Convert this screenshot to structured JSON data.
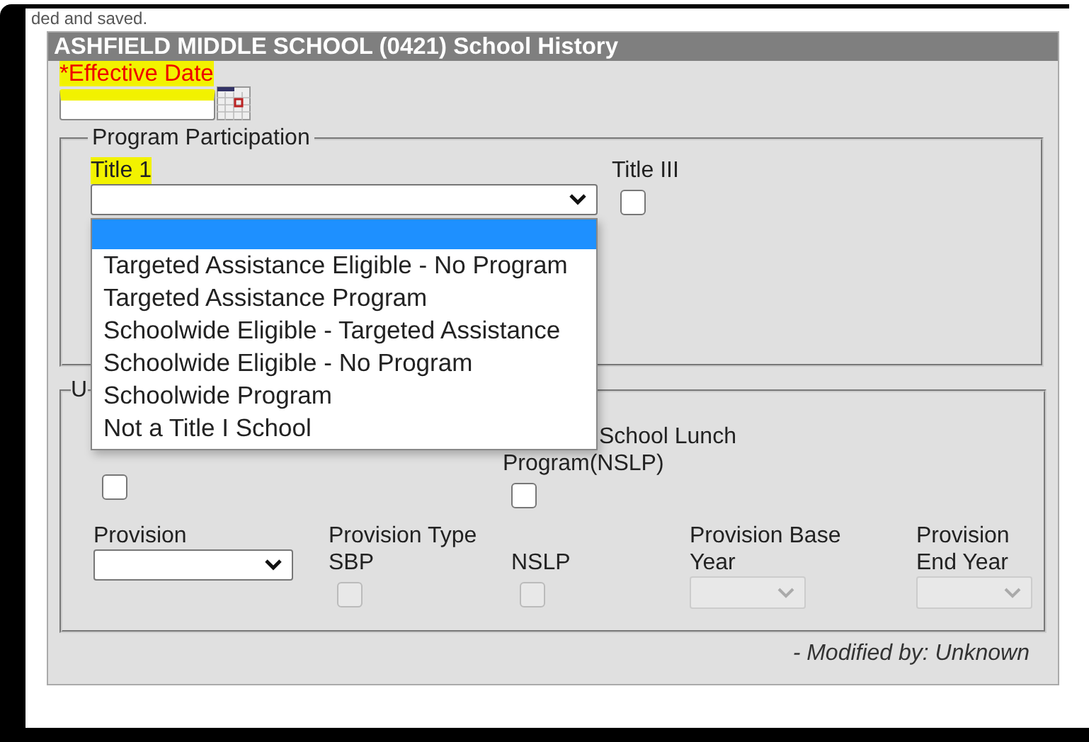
{
  "top_note": "ded and saved.",
  "panel": {
    "title": "ASHFIELD MIDDLE SCHOOL (0421) School History"
  },
  "effective_date": {
    "label": "*Effective Date",
    "highlighted": true
  },
  "program_participation": {
    "legend": "Program Participation",
    "title1": {
      "label": "Title 1",
      "highlighted": true,
      "expanded": true,
      "options": [
        {
          "selected": true
        },
        {
          "label": "Targeted Assistance Eligible - No Program",
          "selected": false
        },
        {
          "label": "Targeted Assistance Program",
          "selected": false
        },
        {
          "label": "Schoolwide Eligible - Targeted Assistance",
          "selected": false
        },
        {
          "label": "Schoolwide Eligible - No Program",
          "selected": false
        },
        {
          "label": "Schoolwide Program",
          "selected": false
        },
        {
          "label": "Not a Title I School",
          "selected": false
        }
      ]
    },
    "title3": {
      "label": "Title III",
      "checked": false
    }
  },
  "usda": {
    "legend": "U",
    "left_checkbox": {
      "checked": false
    },
    "nslp": {
      "label": "School Lunch Program(NSLP)",
      "checked": false
    },
    "provision": {
      "label": "Provision",
      "disabled": false
    },
    "provision_type": {
      "label": "Provision Type SBP",
      "checked": false,
      "disabled": true
    },
    "provision_nslp": {
      "label": "NSLP",
      "checked": false,
      "disabled": true
    },
    "provision_base_year": {
      "label": "Provision Base Year",
      "disabled": true
    },
    "provision_end_year": {
      "label": "Provision End Year",
      "disabled": true
    }
  },
  "footer": {
    "modified_by": "- Modified by: Unknown"
  }
}
